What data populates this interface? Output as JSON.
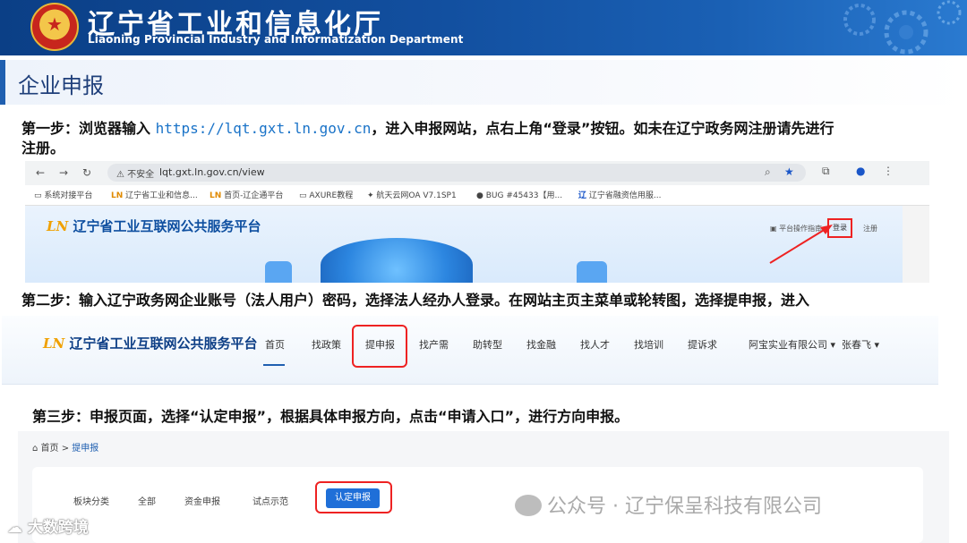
{
  "banner": {
    "title": "辽宁省工业和信息化厅",
    "subtitle": "Liaoning Provincial Industry and Informatization Department"
  },
  "section": {
    "title": "企业申报"
  },
  "steps": {
    "step1": {
      "prefix": "第一步：浏览器输入 ",
      "url": "https://lqt.gxt.ln.gov.cn",
      "suffix": "，进入申报网站，点右上角“登录”按钮。如未在辽宁政务网注册请先进行",
      "line2": "注册。"
    },
    "step2": "第二步：输入辽宁政务网企业账号（法人用户）密码，选择法人经办人登录。在网站主页主菜单或轮转图，选择提申报，进入",
    "step3": "第三步：申报页面，选择“认定申报”，根据具体申报方向，点击“申请入口”，进行方向申报。"
  },
  "browser": {
    "address_warning": "⚠ 不安全",
    "address_url": "lqt.gxt.ln.gov.cn/view",
    "bookmarks": [
      "系统对接平台",
      "辽宁省工业和信息...",
      "首页-辽企通平台",
      "AXURE教程",
      "航天云网OA V7.1SP1",
      "BUG #45433【用...",
      "辽宁省融资信用服..."
    ],
    "site_mark": "LN",
    "site_title": "辽宁省工业互联网公共服务平台",
    "guide": "平台操作指南",
    "login": "登录",
    "register": "注册"
  },
  "nav": {
    "mark": "LN",
    "logo": "辽宁省工业互联网公共服务平台",
    "items": [
      "首页",
      "找政策",
      "提申报",
      "找产需",
      "助转型",
      "找金融",
      "找人才",
      "找培训",
      "提诉求"
    ],
    "company": "阿宝实业有限公司 ▾",
    "user": "张春飞 ▾"
  },
  "crumb": {
    "home": "首页",
    "sep": " > ",
    "current": "提申报"
  },
  "tabs": {
    "label": "板块分类",
    "items": [
      "全部",
      "资金申报",
      "试点示范"
    ],
    "active": "认定申报"
  },
  "watermarks": {
    "official": "公众号 · 辽宁保呈科技有限公司",
    "corner": "大数跨境"
  },
  "colors": {
    "banner": "#124f9f",
    "accent": "#1f5fb0",
    "highlight": "#ee2222",
    "link": "#1a73c8"
  }
}
